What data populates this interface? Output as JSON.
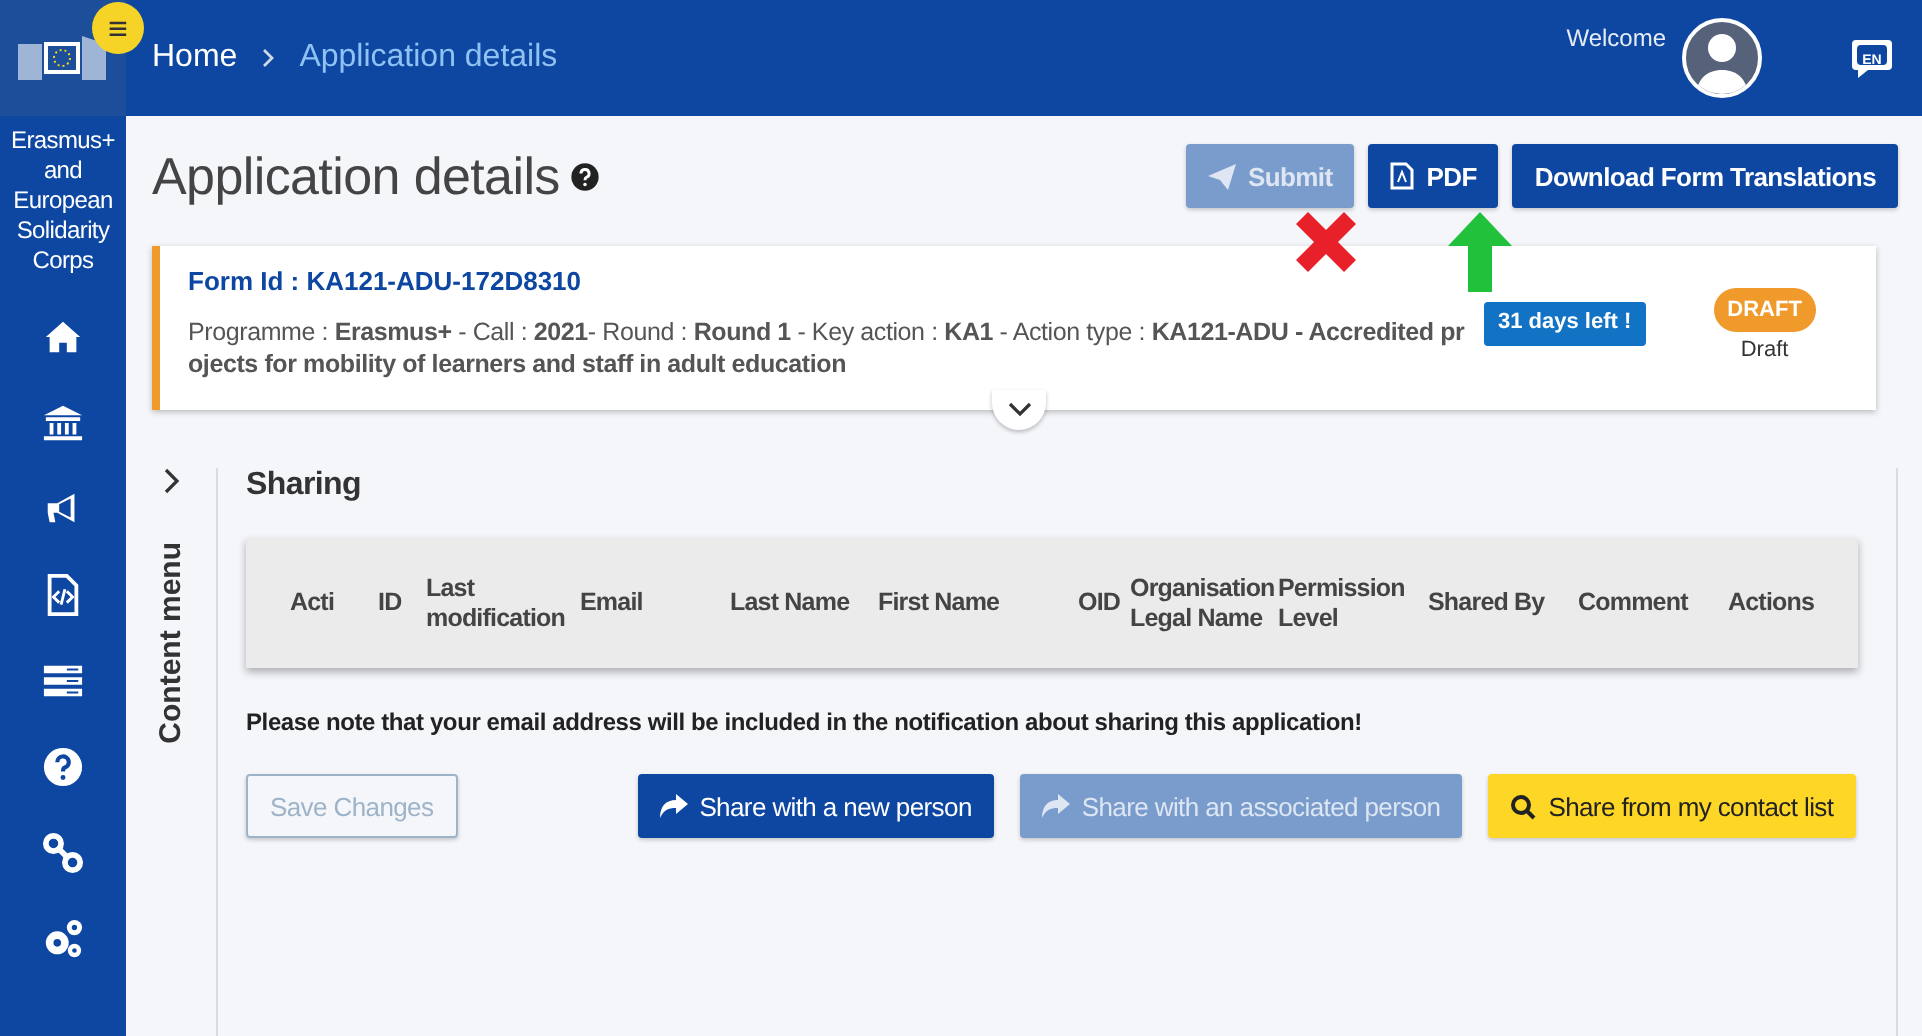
{
  "sidebar": {
    "menu_badge": "≡",
    "program": "Erasmus+ and European Solidarity Corps",
    "items": [
      {
        "kind": "home"
      },
      {
        "kind": "bank"
      },
      {
        "kind": "megaphone"
      },
      {
        "kind": "code-file"
      },
      {
        "kind": "list"
      },
      {
        "kind": "help"
      },
      {
        "kind": "link"
      },
      {
        "kind": "gears"
      }
    ]
  },
  "topbar": {
    "breadcrumb": [
      {
        "label": "Home",
        "current": false
      },
      {
        "label": "Application details",
        "current": true
      }
    ],
    "welcome": "Welcome",
    "language": "EN"
  },
  "header": {
    "title": "Application details",
    "buttons": [
      {
        "label": "Submit",
        "kind": "submit",
        "disabled": true
      },
      {
        "label": "PDF",
        "kind": "pdf",
        "disabled": false
      },
      {
        "label": "Download Form Translations",
        "kind": "plain",
        "disabled": false
      }
    ]
  },
  "annotations": [
    {
      "kind": "cross"
    },
    {
      "kind": "arrow"
    }
  ],
  "form": {
    "id": "Form Id : KA121-ADU-172D8310",
    "description": "Programme : **Erasmus+** - Call : **2021**- Round : **Round 1** - Key action : **KA1** - Action type : **KA121-ADU - Accredited projects for mobility of learners and staff in adult education**",
    "deadline": "31 days left !",
    "status": "DRAFT",
    "status_label": "Draft"
  },
  "content_menu": {
    "label": "Content menu",
    "expanded": false
  },
  "sharing": {
    "title": "Sharing",
    "columns": [
      "Acti",
      "ID",
      "Last modification",
      "Email",
      "Last Name",
      "First Name",
      "OID",
      "Organisation Legal Name",
      "Permission Level",
      "Shared By",
      "Comment",
      "Actions"
    ],
    "note": "Please note that your email address will be included in the notification about sharing this application!",
    "buttons": [
      {
        "label": "Save Changes",
        "kind": "outline",
        "disabled": true
      },
      {
        "label": "Share with a new person",
        "kind": "share",
        "disabled": false
      },
      {
        "label": "Share with an associated person",
        "kind": "share",
        "disabled": true
      },
      {
        "label": "Share from my contact list",
        "kind": "search",
        "disabled": false
      }
    ]
  }
}
